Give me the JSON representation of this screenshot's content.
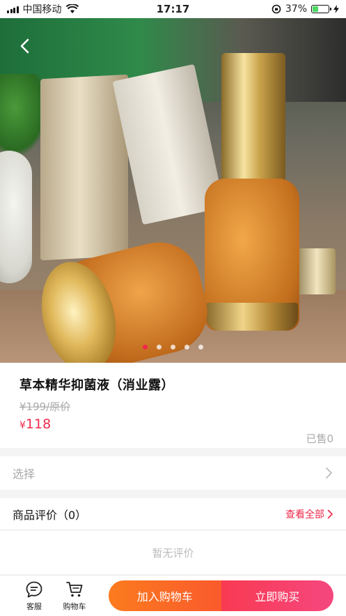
{
  "status_bar": {
    "carrier": "中国移动",
    "time": "17:17",
    "battery": "37%",
    "battery_level": 0.37
  },
  "gallery": {
    "image_count": 5,
    "active_index": 0
  },
  "product": {
    "title": "草本精华抑菌液（消业露）",
    "original_price": "¥199/原价",
    "currency": "¥",
    "price": "118",
    "sold": "已售0"
  },
  "options": {
    "select_label": "选择"
  },
  "reviews": {
    "header": "商品评价（0）",
    "view_all": "查看全部",
    "empty_text": "暂无评价"
  },
  "bottom_bar": {
    "service_label": "客服",
    "cart_label": "购物车",
    "add_to_cart": "加入购物车",
    "buy_now": "立即购买"
  },
  "colors": {
    "accent_red": "#ef2a4b",
    "cart_orange": "#fb7b1e",
    "battery_green": "#4cd964"
  }
}
